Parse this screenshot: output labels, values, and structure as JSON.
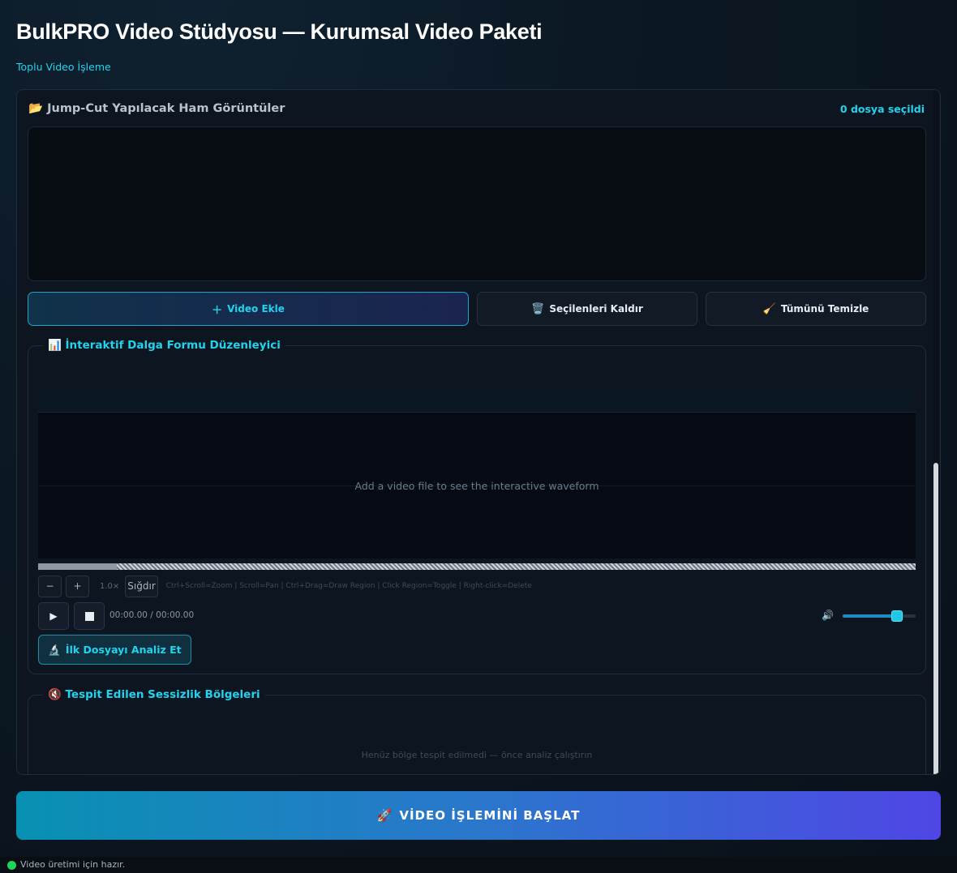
{
  "app": {
    "title": "BulkPRO Video Stüdyosu — Kurumsal Video Paketi",
    "subtitle": "Toplu Video İşleme"
  },
  "files": {
    "header_icon": "folder-icon",
    "header": "📂  Jump-Cut Yapılacak Ham Görüntüler",
    "count_label": "0 dosya seçildi",
    "items": []
  },
  "file_actions": {
    "add_icon": "＋",
    "add_label": "Video Ekle",
    "remove_icon": "🗑️",
    "remove_label": "Seçilenleri Kaldır",
    "clear_icon": "🧹",
    "clear_label": "Tümünü Temizle"
  },
  "waveform": {
    "section_icon": "chart-icon",
    "section_title": "📊  İnteraktif Dalga Formu Düzenleyici",
    "placeholder": "Add a video file to see the interactive waveform",
    "zoom_out_label": "−",
    "zoom_in_label": "+",
    "zoom_level": "1.0×",
    "fit_label": "Sığdır",
    "hints": "Ctrl+Scroll=Zoom  |  Scroll=Pan  |  Ctrl+Drag=Draw Region  |  Click Region=Toggle  |  Right-click=Delete",
    "play_label": "▶",
    "time": "00:00.00 / 00:00.00",
    "volume_icon": "🔊",
    "volume_level": 0.74,
    "analyze_icon": "🔬",
    "analyze_label": "İlk Dosyayı Analiz Et"
  },
  "silence": {
    "section_icon": "mute-icon",
    "section_title": "🔇  Tespit Edilen Sessizlik Bölgeleri",
    "empty_text": "Henüz bölge tespit edilmedi — önce analiz çalıştırın"
  },
  "start": {
    "icon": "🚀",
    "label": "VİDEO İŞLEMİNİ BAŞLAT"
  },
  "status": {
    "color": "#1ed45a",
    "text": "Video üretimi için hazır."
  },
  "colors": {
    "accent": "#22d3ee",
    "gradient_start": "#0891b2",
    "gradient_end": "#4f46e5"
  }
}
